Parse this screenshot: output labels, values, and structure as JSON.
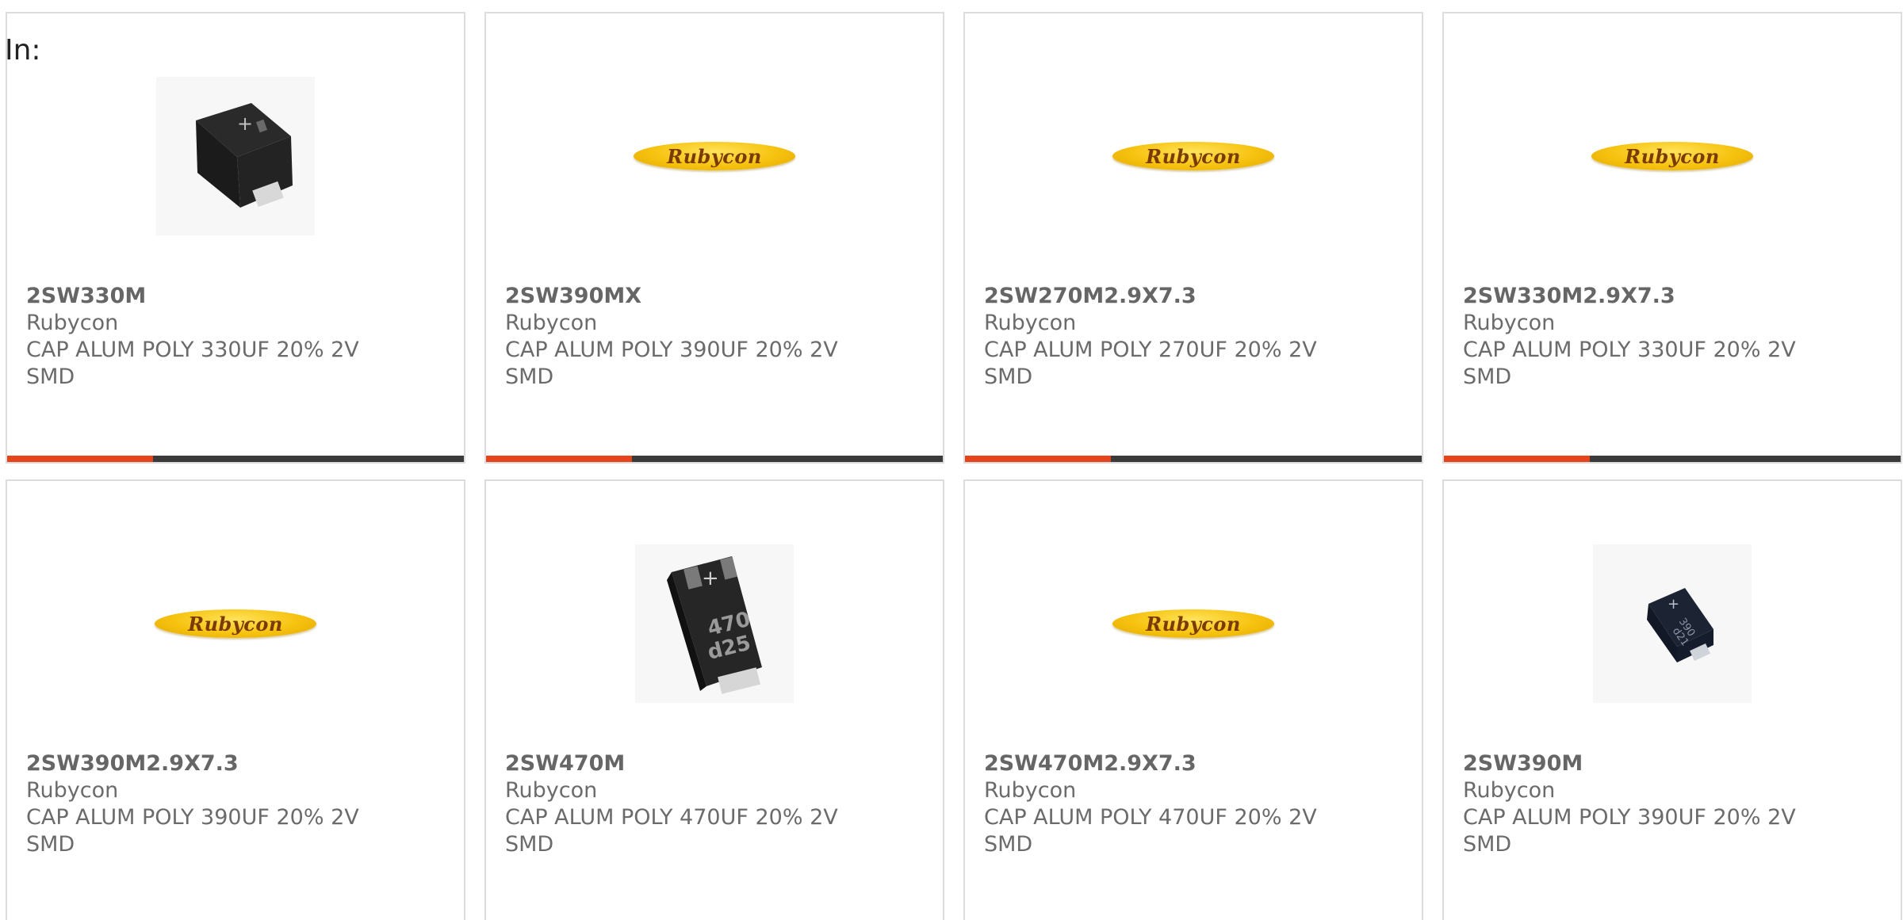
{
  "label": "In:",
  "brand_logo_text": "Rubycon",
  "colors": {
    "accent_bar": "#e8441b",
    "bar_track": "#3a3a3a",
    "card_border": "#dcdcdc",
    "text": "#6b6b6b"
  },
  "cards": [
    {
      "part": "2SW330M",
      "maker": "Rubycon",
      "desc1": "CAP ALUM POLY 330UF 20% 2V",
      "desc2": "SMD",
      "image": "capacitor-photo",
      "progress": 0.32
    },
    {
      "part": "2SW390MX",
      "maker": "Rubycon",
      "desc1": "CAP ALUM POLY 390UF 20% 2V",
      "desc2": "SMD",
      "image": "rubycon-logo",
      "progress": 0.32
    },
    {
      "part": "2SW270M2.9X7.3",
      "maker": "Rubycon",
      "desc1": "CAP ALUM POLY 270UF 20% 2V",
      "desc2": "SMD",
      "image": "rubycon-logo",
      "progress": 0.32
    },
    {
      "part": "2SW330M2.9X7.3",
      "maker": "Rubycon",
      "desc1": "CAP ALUM POLY 330UF 20% 2V",
      "desc2": "SMD",
      "image": "rubycon-logo",
      "progress": 0.32
    },
    {
      "part": "2SW390M2.9X7.3",
      "maker": "Rubycon",
      "desc1": "CAP ALUM POLY 390UF 20% 2V",
      "desc2": "SMD",
      "image": "rubycon-logo"
    },
    {
      "part": "2SW470M",
      "maker": "Rubycon",
      "desc1": "CAP ALUM POLY 470UF 20% 2V",
      "desc2": "SMD",
      "image": "capacitor-photo",
      "photo_marking1": "470",
      "photo_marking2": "d25"
    },
    {
      "part": "2SW470M2.9X7.3",
      "maker": "Rubycon",
      "desc1": "CAP ALUM POLY 470UF 20% 2V",
      "desc2": "SMD",
      "image": "rubycon-logo"
    },
    {
      "part": "2SW390M",
      "maker": "Rubycon",
      "desc1": "CAP ALUM POLY 390UF 20% 2V",
      "desc2": "SMD",
      "image": "capacitor-photo",
      "photo_marking1": "390",
      "photo_marking2": "d21"
    }
  ]
}
